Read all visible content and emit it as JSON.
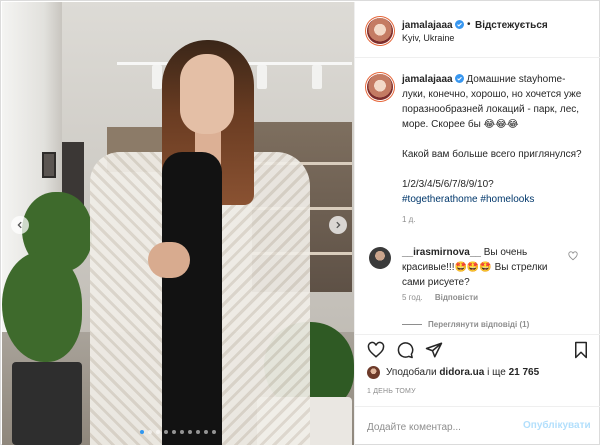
{
  "post": {
    "author": "jamalajaaa",
    "follow_label": "Відстежується",
    "separator": "•",
    "location": "Kyiv, Ukraine"
  },
  "caption": {
    "author": "jamalajaaa",
    "text_1": "Домашние stayhome-луки, конечно, хорошо, но хочется уже поразнообразней локаций - парк, лес, море. Скорее бы 😂😂😂",
    "text_2": "Какой вам больше всего приглянулся?",
    "text_3": "1/2/3/4/5/6/7/8/9/10?",
    "hashtag_1": "#togetherathome",
    "hashtag_2": "#homelooks",
    "time": "1 д."
  },
  "comment": {
    "author": "__irasmirnova__",
    "text": "Вы очень красивые!!!🤩🤩🤩 Вы стрелки сами рисуете?",
    "time": "5 год.",
    "reply_label": "Відповісти",
    "view_replies": "Переглянути відповіді (1)"
  },
  "likes": {
    "prefix": "Уподобали",
    "user": "didora.ua",
    "middle": "і ще",
    "count": "21 765"
  },
  "post_date": "1 ДЕНЬ ТОМУ",
  "add_comment": {
    "placeholder": "Додайте коментар...",
    "publish_label": "Опублікувати"
  },
  "carousel": {
    "slide_count": 10,
    "active_index": 0
  },
  "colors": {
    "text": "#262626",
    "secondary": "#8e8e8e",
    "link": "#00376b",
    "verified": "#3897f0",
    "publish_disabled": "#b2dffc"
  },
  "icons": {
    "verified": "verified-badge-icon",
    "heart": "heart-icon",
    "comment": "comment-icon",
    "share": "share-icon",
    "save": "bookmark-icon",
    "prev": "chevron-left-icon",
    "next": "chevron-right-icon"
  }
}
